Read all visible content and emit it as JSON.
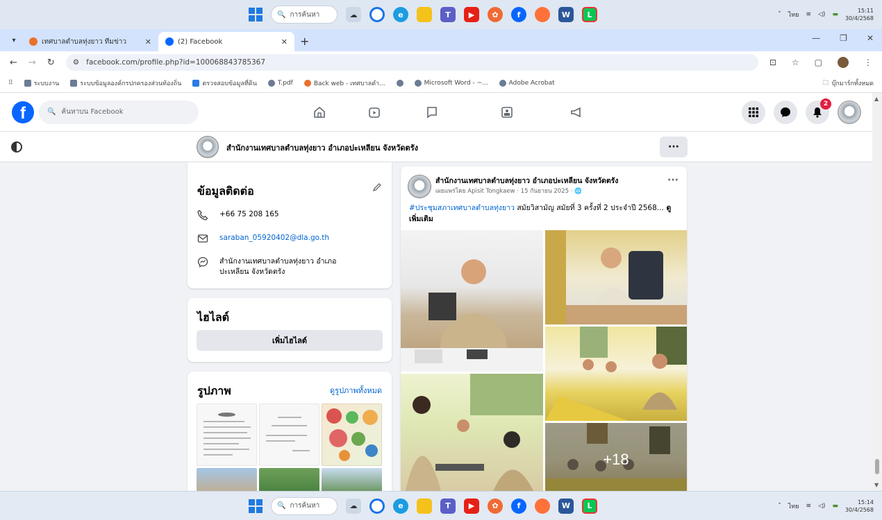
{
  "taskbar": {
    "search_placeholder": "การค้นหา",
    "apps": [
      "widgets",
      "chrome",
      "edge",
      "file-explorer",
      "teams",
      "youtube",
      "photos",
      "facebook",
      "firefox",
      "word",
      "line"
    ],
    "clock_time": "15:11",
    "clock_date": "30/4/2568",
    "clock_time_bottom": "15:14",
    "clock_date_bottom": "30/4/2568",
    "lang": "ไทย"
  },
  "tabs": [
    {
      "label": "เทศบาลตำบลทุ่งยาว ทีมข่าว",
      "color": "#e8712b"
    },
    {
      "label": "(2) Facebook",
      "color": "#0866ff"
    }
  ],
  "address": {
    "url": "facebook.com/profile.php?id=100068843785367"
  },
  "bookmarks": [
    "ระบบงาน",
    "ระบบข้อมูลองค์กรปกครองส่วนท้องถิ่น",
    "ตรวจสอบข้อมูลที่ดิน",
    "T.pdf",
    "Back web - เทศบาลตำ...",
    "",
    "Microsoft Word - ~...",
    "Adobe Acrobat"
  ],
  "bookmarks_all": "บุ๊กมาร์กทั้งหมด",
  "facebook": {
    "search_placeholder": "ค้นหาบน Facebook",
    "notif_count": "2",
    "page_name": "สำนักงานเทศบาลตำบลทุ่งยาว อำเภอปะเหลียน จังหวัดตรัง",
    "contact": {
      "title": "ข้อมูลติดต่อ",
      "phone": "+66 75 208 165",
      "email": "saraban_05920402@dla.go.th",
      "messenger": "สำนักงานเทศบาลตำบลทุ่งยาว อำเภอปะเหลียน จังหวัดตรัง"
    },
    "highlights": {
      "title": "ไฮไลต์",
      "add_label": "เพิ่มไฮไลต์"
    },
    "photos": {
      "title": "รูปภาพ",
      "see_all": "ดูรูปภาพทั้งหมด"
    },
    "post": {
      "author": "สำนักงานเทศบาลตำบลทุ่งยาว อำเภอปะเหลียน จังหวัดตรัง",
      "meta": "เผยแพร่โดย Apisit Tongkaew · 15 กันยายน 2025 ·",
      "hashtag": "#ประชุมสภาเทศบาลตำบลทุ่งยาว",
      "text": " สมัยวิสามัญ สมัยที่ 3 ครั้งที่ 2 ประจำปี 2568...",
      "see_more": " ดูเพิ่มเติม",
      "more_count": "+18"
    }
  }
}
